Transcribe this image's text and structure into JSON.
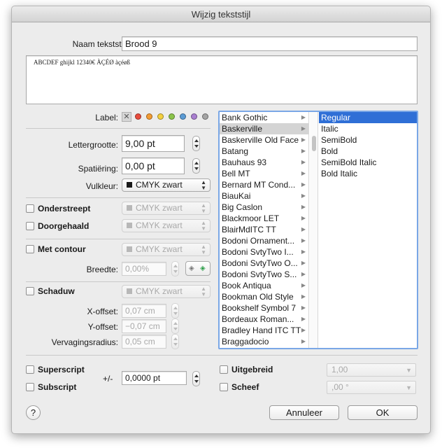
{
  "dialog": {
    "title": "Wijzig tekststijl"
  },
  "name_field": {
    "label": "Naam tekststijl:",
    "value": "Brood 9"
  },
  "preview": {
    "text": "ABCDEF ghijkl 12340€ ÀÇÉØ àçéøß"
  },
  "label_row": {
    "label": "Label:",
    "colors": [
      "#e84c3d",
      "#f39c34",
      "#f4d03f",
      "#8bc34a",
      "#5b9bd5",
      "#a97fd0",
      "#a5a5a5"
    ]
  },
  "font_size": {
    "label": "Lettergrootte:",
    "value": "9,00 pt"
  },
  "tracking": {
    "label": "Spatiëring:",
    "value": "0,00 pt"
  },
  "fill_color": {
    "label": "Vulkleur:",
    "value": "CMYK zwart",
    "swatch": "#1a1a1a"
  },
  "underline": {
    "label": "Onderstreept",
    "color": "CMYK zwart"
  },
  "strikethrough": {
    "label": "Doorgehaald",
    "color": "CMYK zwart"
  },
  "outline": {
    "label": "Met contour",
    "color": "CMYK zwart",
    "width_label": "Breedte:",
    "width_value": "0,00%"
  },
  "shadow": {
    "label": "Schaduw",
    "color": "CMYK zwart",
    "x_label": "X-offset:",
    "x_value": "0,07 cm",
    "y_label": "Y-offset:",
    "y_value": "−0,07 cm",
    "blur_label": "Vervagingsradius:",
    "blur_value": "0,05 cm"
  },
  "fonts": [
    "Bank Gothic",
    "Baskerville",
    "Baskerville Old Face",
    "Batang",
    "Bauhaus 93",
    "Bell MT",
    "Bernard MT Cond...",
    "BiauKai",
    "Big Caslon",
    "Blackmoor LET",
    "BlairMdITC TT",
    "Bodoni Ornament...",
    "Bodoni SvtyTwo I...",
    "Bodoni SvtyTwo O...",
    "Bodoni SvtyTwo S...",
    "Book Antiqua",
    "Bookman Old Style",
    "Bookshelf Symbol 7",
    "Bordeaux Roman...",
    "Bradley Hand ITC TT",
    "Braggadocio"
  ],
  "selected_font": "Baskerville",
  "styles": [
    "Regular",
    "Italic",
    "SemiBold",
    "Bold",
    "SemiBold Italic",
    "Bold Italic"
  ],
  "selected_style": "Regular",
  "superscript": {
    "label": "Superscript"
  },
  "subscript": {
    "label": "Subscript"
  },
  "offset": {
    "label": "+/-",
    "value": "0,0000 pt"
  },
  "expanded": {
    "label": "Uitgebreid",
    "value": "1,00"
  },
  "slant": {
    "label": "Scheef",
    "value": ",00 °"
  },
  "buttons": {
    "cancel": "Annuleer",
    "ok": "OK",
    "help": "?"
  }
}
